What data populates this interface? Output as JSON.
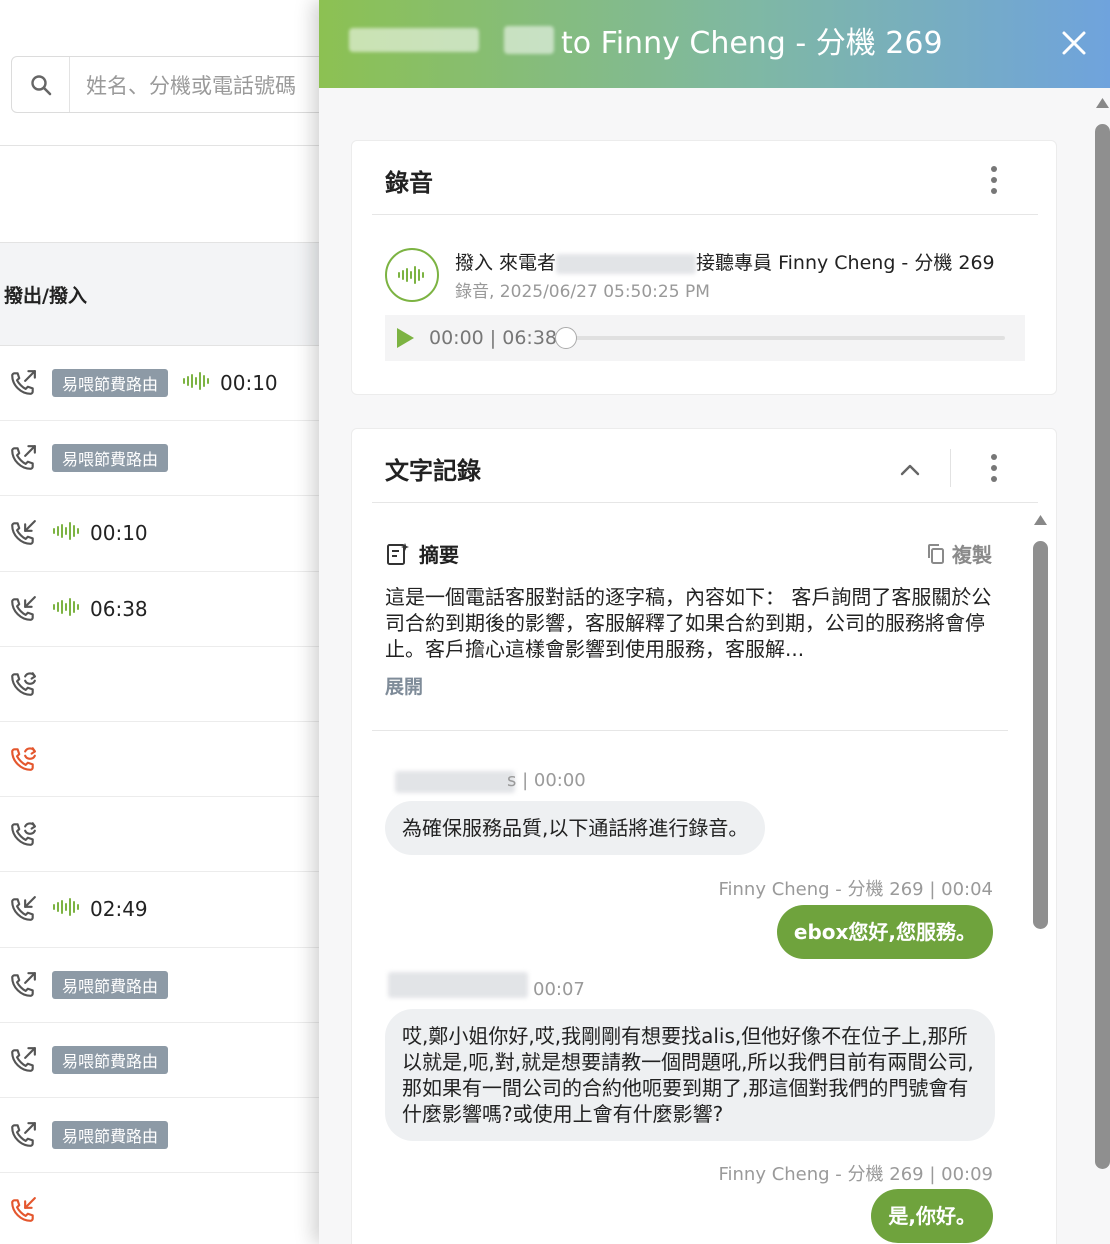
{
  "search": {
    "placeholder": "姓名、分機或電話號碼"
  },
  "list": {
    "column_header": "撥出/撥入",
    "rows": [
      {
        "direction": "out",
        "color": "#555555",
        "tag": "易喂節費路由",
        "duration": "00:10"
      },
      {
        "direction": "out",
        "color": "#555555",
        "tag": "易喂節費路由",
        "duration": ""
      },
      {
        "direction": "in",
        "color": "#555555",
        "tag": "",
        "duration": "00:10"
      },
      {
        "direction": "in",
        "color": "#555555",
        "tag": "",
        "duration": "06:38"
      },
      {
        "direction": "transfer",
        "color": "#555555",
        "tag": "",
        "duration": ""
      },
      {
        "direction": "transfer",
        "color": "#e4572e",
        "tag": "",
        "duration": ""
      },
      {
        "direction": "transfer",
        "color": "#555555",
        "tag": "",
        "duration": ""
      },
      {
        "direction": "in",
        "color": "#555555",
        "tag": "",
        "duration": "02:49"
      },
      {
        "direction": "out",
        "color": "#555555",
        "tag": "易喂節費路由",
        "duration": ""
      },
      {
        "direction": "out",
        "color": "#555555",
        "tag": "易喂節費路由",
        "duration": ""
      },
      {
        "direction": "out",
        "color": "#555555",
        "tag": "易喂節費路由",
        "duration": ""
      },
      {
        "direction": "in",
        "color": "#e4572e",
        "tag": "",
        "duration": ""
      }
    ]
  },
  "panel": {
    "title": "to Finny Cheng - 分機 269",
    "recording": {
      "title": "錄音",
      "line1_prefix": "撥入 來電者",
      "line1_suffix": "接聽專員 Finny Cheng - 分機 269",
      "line2": "錄音, 2025/06/27 05:50:25 PM",
      "time": "00:00 | 06:38"
    },
    "transcript": {
      "title": "文字記錄",
      "summary_label": "摘要",
      "copy_label": "複製",
      "summary_text": "這是一個電話客服對話的逐字稿，內容如下： 客戶詢問了客服關於公司合約到期後的影響，客服解釋了如果合約到期，公司的服務將會停止。客戶擔心這樣會影響到使用服務，客服解...",
      "expand_label": "展開",
      "messages": [
        {
          "side": "in",
          "meta": "s | 00:00",
          "text": "為確保服務品質,以下通話將進行錄音。"
        },
        {
          "side": "out",
          "meta": "Finny Cheng - 分機 269 | 00:04",
          "text": "ebox您好,您服務。"
        },
        {
          "side": "in",
          "meta": "00:07",
          "text": "哎,鄭小姐你好,哎,我剛剛有想要找alis,但他好像不在位子上,那所以就是,呃,對,就是想要請教一個問題吼,所以我們目前有兩間公司,那如果有一間公司的合約他呃要到期了,那這個對我們的門號會有什麼影響嗎?或使用上會有什麼影響?"
        },
        {
          "side": "out",
          "meta": "Finny Cheng - 分機 269 | 00:09",
          "text": "是,你好。"
        }
      ]
    }
  },
  "colors": {
    "accent_green": "#7cb342",
    "bubble_green": "#6fa33d",
    "missed_red": "#e4572e",
    "tag_grey": "#8d9aa6"
  }
}
